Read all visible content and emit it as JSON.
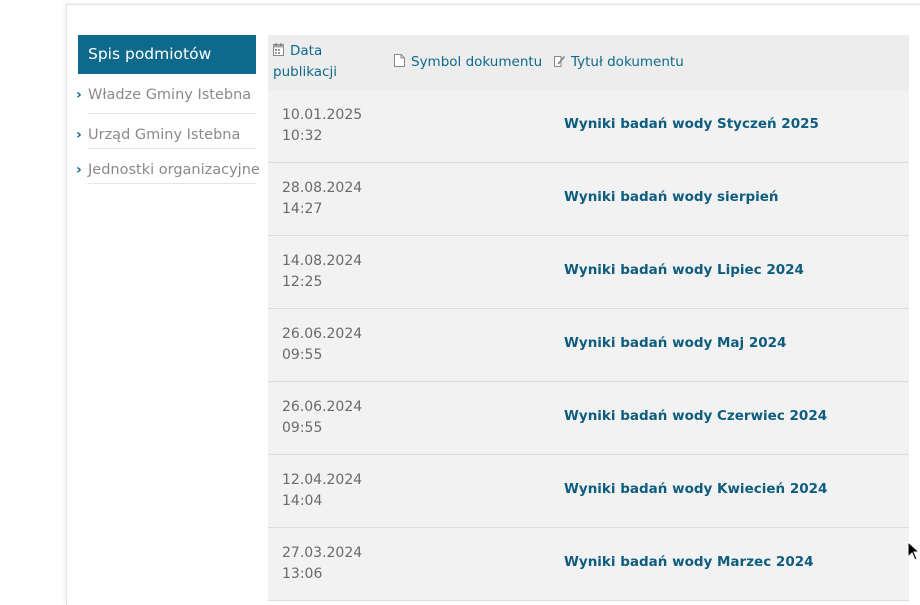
{
  "sidebar": {
    "header": "Spis podmiotów",
    "items": [
      {
        "label": "Władze Gminy Istebna"
      },
      {
        "label": "Urząd Gminy Istebna"
      },
      {
        "label": "Jednostki organizacyjne"
      }
    ]
  },
  "table": {
    "headers": {
      "date": "Data publikacji",
      "symbol": "Symbol dokumentu",
      "title": "Tytuł dokumentu"
    },
    "rows": [
      {
        "date": "10.01.2025",
        "time": "10:32",
        "symbol": "",
        "title": "Wyniki badań wody Styczeń 2025"
      },
      {
        "date": "28.08.2024",
        "time": "14:27",
        "symbol": "",
        "title": "Wyniki badań wody sierpień"
      },
      {
        "date": "14.08.2024",
        "time": "12:25",
        "symbol": "",
        "title": "Wyniki badań wody Lipiec 2024"
      },
      {
        "date": "26.06.2024",
        "time": "09:55",
        "symbol": "",
        "title": "Wyniki badań wody Maj 2024"
      },
      {
        "date": "26.06.2024",
        "time": "09:55",
        "symbol": "",
        "title": "Wyniki badań wody Czerwiec 2024"
      },
      {
        "date": "12.04.2024",
        "time": "14:04",
        "symbol": "",
        "title": "Wyniki badań wody Kwiecień 2024"
      },
      {
        "date": "27.03.2024",
        "time": "13:06",
        "symbol": "",
        "title": "Wyniki badań wody Marzec 2024"
      }
    ]
  },
  "colors": {
    "accent": "#0e6a8c",
    "link": "#0e5d7e",
    "row_bg": "#f2f2f2"
  },
  "icons": {
    "date_header": "calendar-icon",
    "symbol_header": "document-icon",
    "title_header": "edit-icon",
    "sidebar_bullet": "chevron-right-icon"
  }
}
